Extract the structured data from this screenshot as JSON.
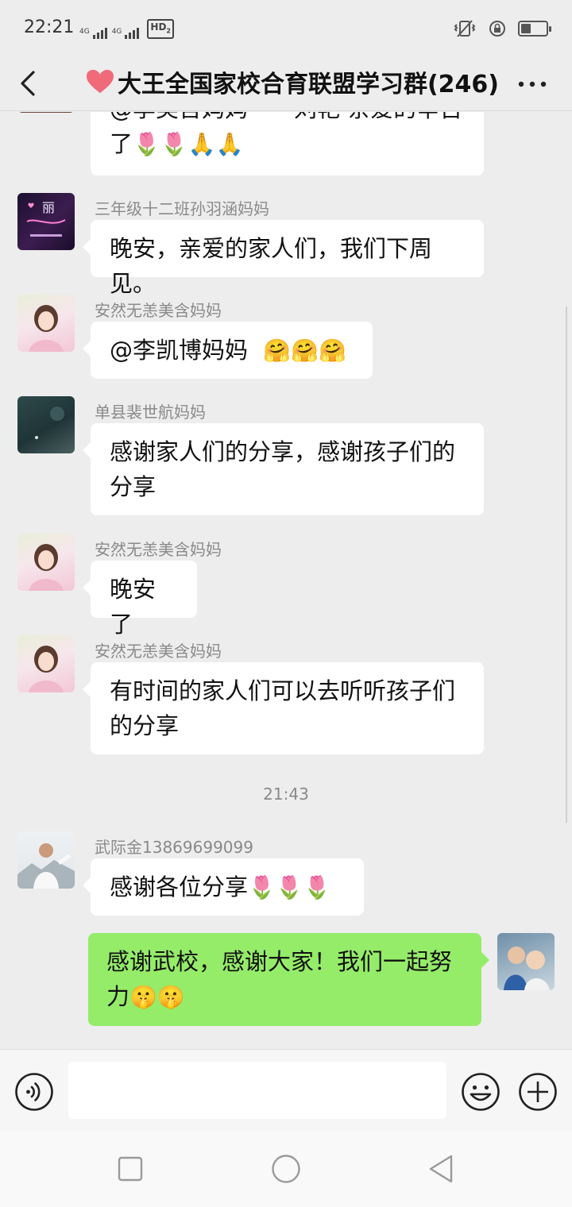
{
  "status_bar": {
    "time": "22:21",
    "signal_labels": [
      "4G",
      "4G"
    ],
    "hd_label": "HD",
    "hd_sub": "2",
    "icons": [
      "vibrate-icon",
      "rotation-lock-icon",
      "battery-icon"
    ],
    "battery_level": 0.4
  },
  "header": {
    "back_icon": "chevron-left-icon",
    "title_icon": "red-heart-emoji",
    "title": "大王全国家校合育联盟学习群(246)",
    "more_icon": "more-dots-icon"
  },
  "messages": [
    {
      "id": "m0",
      "sender": "",
      "text": "@李美含妈妈一一刘艳 亲爱的辛苦了",
      "emojis": "🌷🌷🙏🙏"
    },
    {
      "id": "m1",
      "sender": "三年级十二班孙羽涵妈妈",
      "avatar_text": "丽",
      "text": "晚安，亲爱的家人们，我们下周见。"
    },
    {
      "id": "m2",
      "sender": "安然无恙美含妈妈",
      "text": "@李凯博妈妈",
      "emojis": "🤗🤗🤗"
    },
    {
      "id": "m3",
      "sender": "单县裴世航妈妈",
      "text": "感谢家人们的分享，感谢孩子们的分享"
    },
    {
      "id": "m4",
      "sender": "安然无恙美含妈妈",
      "text": "晚安了"
    },
    {
      "id": "m5",
      "sender": "安然无恙美含妈妈",
      "text": "有时间的家人们可以去听听孩子们的分享"
    },
    {
      "id": "m6",
      "sender": "武际金13869699099",
      "text": "感谢各位分享",
      "emojis": "🌷🌷🌷"
    },
    {
      "id": "m7",
      "sender": "",
      "outgoing": true,
      "text": "感谢武校，感谢大家！我们一起努力",
      "emojis": "🤫🤫"
    }
  ],
  "timestamp": "21:43",
  "input_bar": {
    "voice_icon": "voice-icon",
    "input_value": "",
    "emoji_icon": "emoji-smile-icon",
    "plus_icon": "plus-circle-icon"
  },
  "system_nav": {
    "icons": [
      "recent-apps-icon",
      "home-icon",
      "back-triangle-icon"
    ]
  },
  "colors": {
    "background": "#ededed",
    "incoming_bubble": "#ffffff",
    "outgoing_bubble": "#95ec69",
    "sender_text": "#8a8a8a",
    "heart": "#f06a7a"
  }
}
